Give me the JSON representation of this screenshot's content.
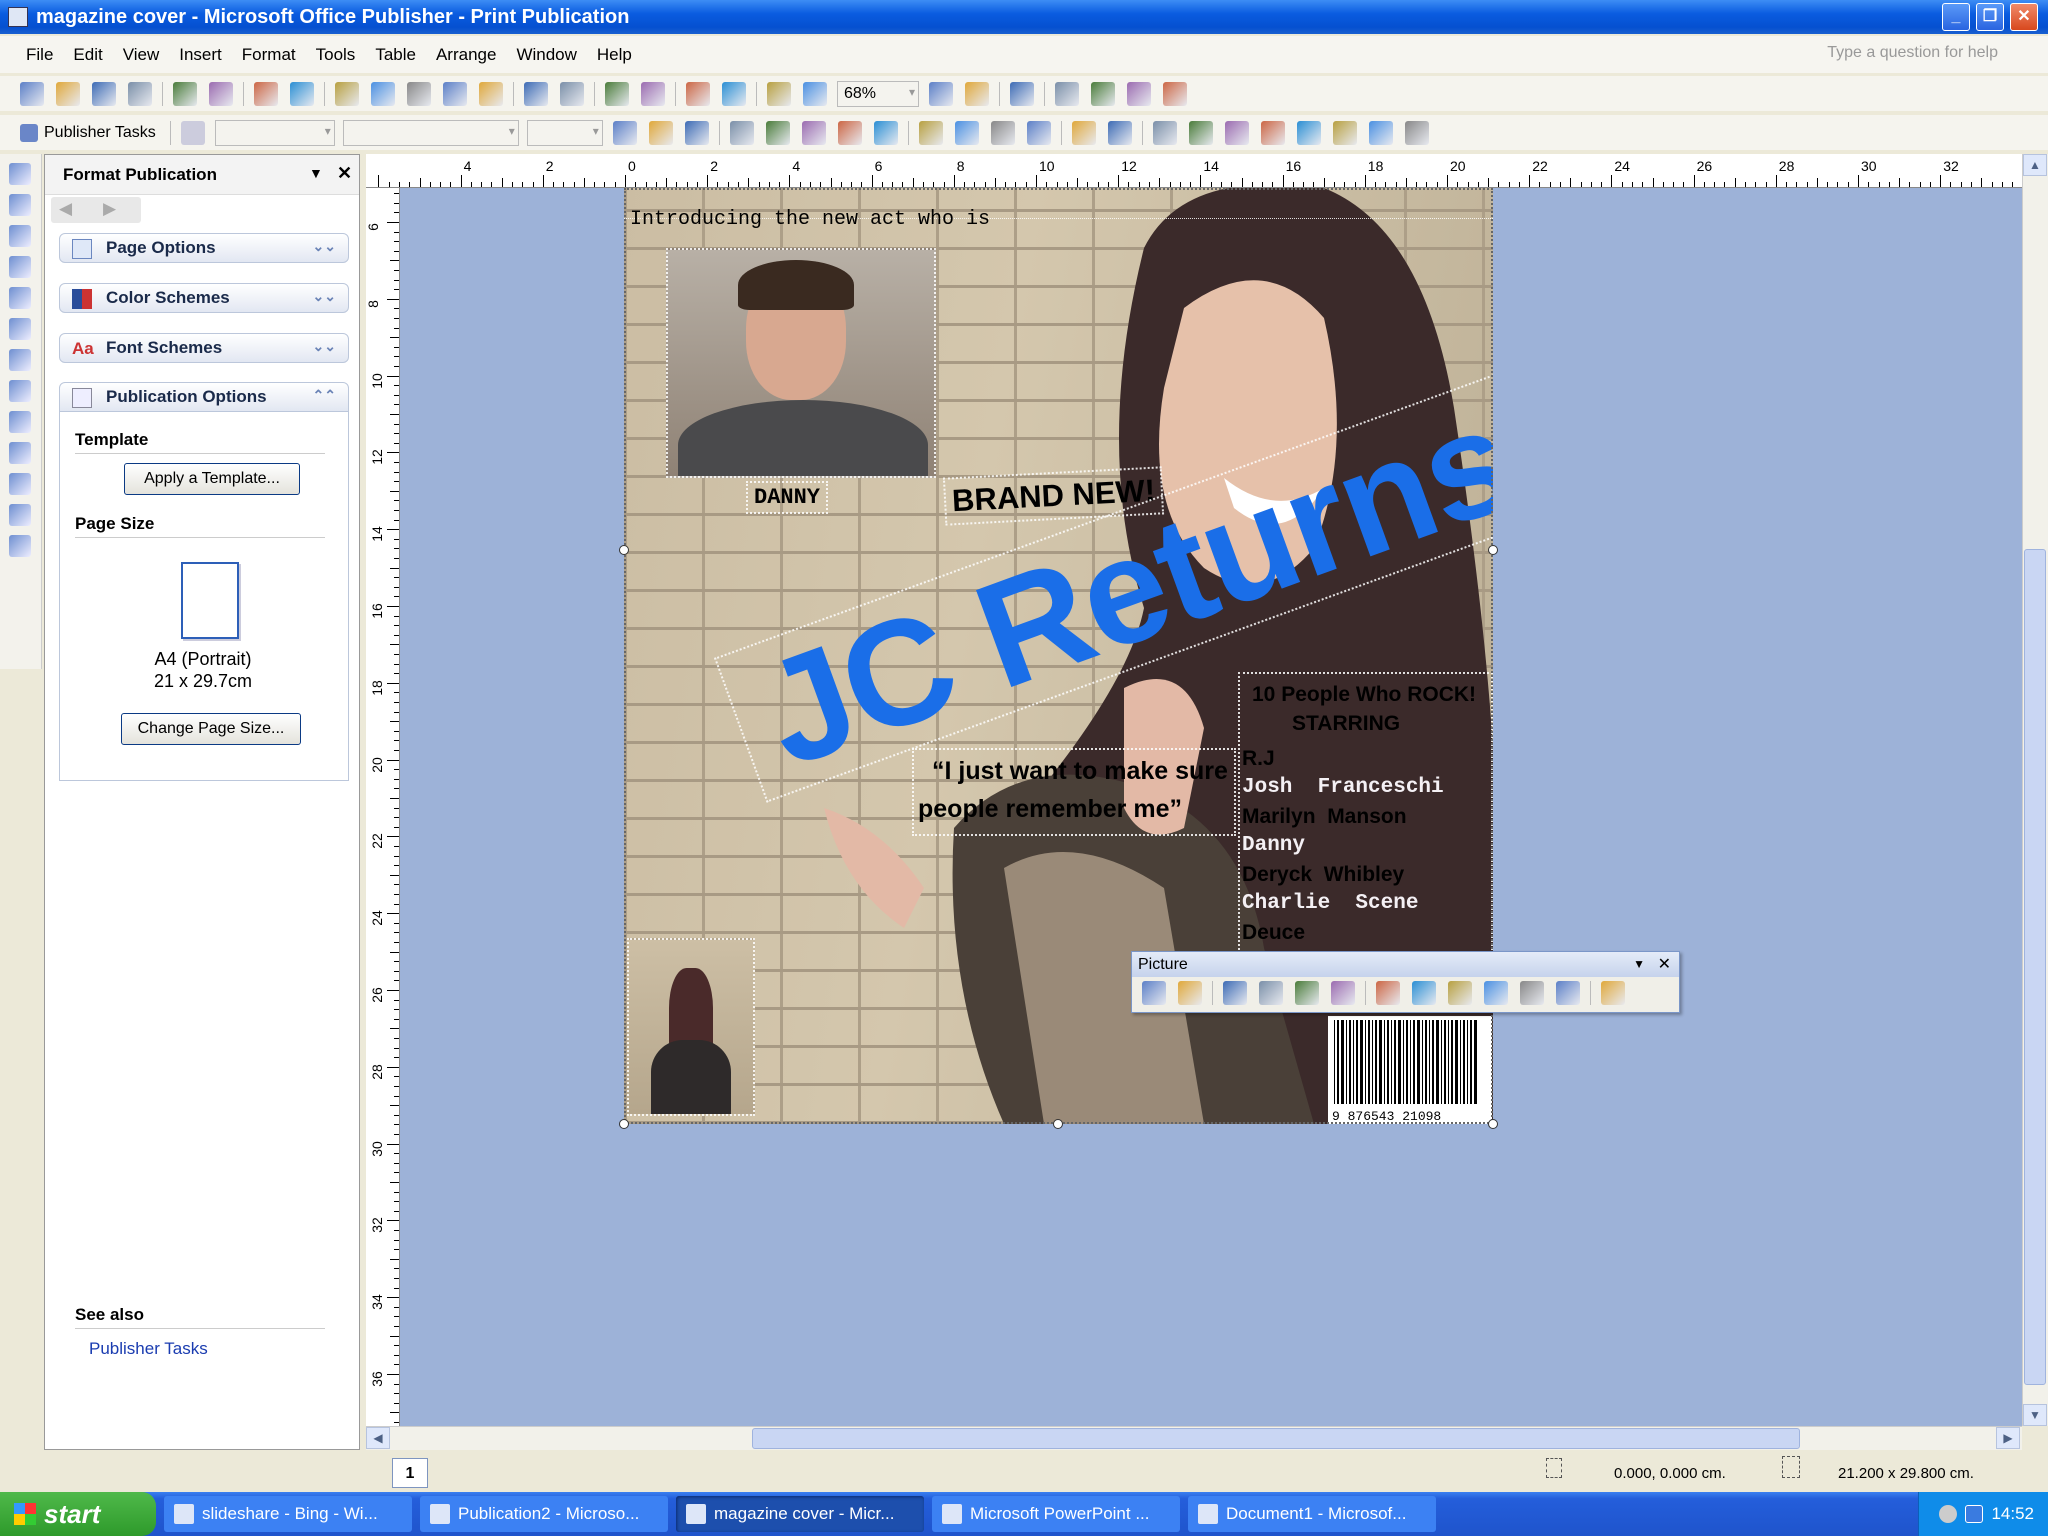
{
  "window": {
    "title": "magazine cover - Microsoft Office Publisher - Print Publication"
  },
  "menu": [
    "File",
    "Edit",
    "View",
    "Insert",
    "Format",
    "Tools",
    "Table",
    "Arrange",
    "Window",
    "Help"
  ],
  "help_placeholder": "Type a question for help",
  "toolbar_standard": {
    "icons": [
      "new-icon",
      "open-icon",
      "save-icon",
      "permission-icon",
      "|",
      "print-icon",
      "print-preview-icon",
      "|",
      "spelling-icon",
      "research-icon",
      "|",
      "cut-icon",
      "copy-icon",
      "paste-icon",
      "format-painter-icon",
      "brush-icon",
      "|",
      "undo-icon",
      "redo-icon",
      "|",
      "bring-to-front-icon",
      "rotate-icon",
      "|",
      "hyperlink-icon",
      "web-preview-icon",
      "|",
      "columns-icon",
      "pilcrow-icon"
    ],
    "zoom": "68%",
    "icons_after": [
      "zoom-out-icon",
      "zoom-in-icon",
      "|",
      "help-icon",
      "|",
      "link-textbox-icon",
      "unlink-textbox-icon",
      "previous-textbox-icon",
      "next-textbox-icon"
    ]
  },
  "toolbar_format": {
    "publisher_tasks": "Publisher Tasks",
    "icons": [
      "bold-icon",
      "italic-icon",
      "underline-icon",
      "|",
      "align-left-icon",
      "center-icon",
      "align-right-icon",
      "justify-icon",
      "line-spacing-icon",
      "|",
      "numbering-icon",
      "bullets-icon",
      "decrease-indent-icon",
      "increase-indent-icon",
      "|",
      "decrease-font-icon",
      "increase-font-icon",
      "|",
      "fill-color-icon",
      "line-color-icon",
      "font-color-icon",
      "line-style-icon",
      "dash-style-icon",
      "arrow-style-icon",
      "shadow-icon",
      "3d-icon"
    ]
  },
  "tools": [
    "select-icon",
    "text-box-icon",
    "table-icon",
    "wordart-icon",
    "picture-icon",
    "line-icon",
    "arrow-icon",
    "oval-icon",
    "rectangle-icon",
    "autoshapes-icon",
    "hot-spot-icon",
    "form-control-icon",
    "design-gallery-icon"
  ],
  "taskpane": {
    "title": "Format Publication",
    "sections": [
      "Page Options",
      "Color Schemes",
      "Font Schemes",
      "Publication Options"
    ],
    "template_label": "Template",
    "apply_template": "Apply a Template...",
    "page_size_label": "Page Size",
    "page_size_name": "A4 (Portrait)",
    "page_size_dims": "21 x 29.7cm",
    "change_page_size": "Change Page Size...",
    "see_also": "See also",
    "publisher_tasks_link": "Publisher Tasks"
  },
  "ruler": {
    "top": [
      "4",
      "2",
      "0",
      "2",
      "4",
      "6",
      "8",
      "10",
      "12",
      "14",
      "16",
      "18",
      "20",
      "22",
      "24",
      "26",
      "28",
      "30",
      "32"
    ],
    "left": [
      "6",
      "8",
      "10",
      "12",
      "14",
      "16",
      "18",
      "20",
      "22",
      "24",
      "26",
      "28",
      "30",
      "32",
      "34",
      "36"
    ]
  },
  "cover": {
    "intro": "Introducing the new act who is",
    "danny_caption": "DANNY",
    "brand_new": "BRAND NEW!",
    "headline": "JC Returns",
    "headline_color": "#1a6ee8",
    "quote_line1": "“I just want to make sure",
    "quote_line2": "people remember me”",
    "list_title": "10 People Who ROCK!",
    "list_sub": "STARRING",
    "list": [
      {
        "name": "R.J",
        "white": false
      },
      {
        "name": "Josh  Franceschi",
        "white": true
      },
      {
        "name": "Marilyn  Manson",
        "white": false
      },
      {
        "name": "Danny",
        "white": true
      },
      {
        "name": "Deryck  Whibley",
        "white": false
      },
      {
        "name": "Charlie  Scene",
        "white": true
      },
      {
        "name": "Deuce",
        "white": false
      }
    ],
    "barcode_number": "9 876543 21098"
  },
  "picture_toolbar": {
    "title": "Picture",
    "icons": [
      "insert-picture-icon",
      "color-icon",
      "|",
      "more-contrast-icon",
      "less-contrast-icon",
      "more-brightness-icon",
      "less-brightness-icon",
      "|",
      "crop-icon",
      "line-style-icon",
      "compress-icon",
      "text-wrapping-icon",
      "format-picture-icon",
      "set-transparent-icon",
      "|",
      "reset-picture-icon"
    ]
  },
  "status": {
    "page": "1",
    "position": "0.000, 0.000 cm.",
    "size": "21.200 x 29.800 cm."
  },
  "taskbar": {
    "start": "start",
    "items": [
      {
        "label": "slideshare - Bing - Wi...",
        "active": false
      },
      {
        "label": "Publication2 - Microso...",
        "active": false
      },
      {
        "label": "magazine cover - Micr...",
        "active": true
      },
      {
        "label": "Microsoft PowerPoint ...",
        "active": false
      },
      {
        "label": "Document1 - Microsof...",
        "active": false
      }
    ],
    "clock": "14:52"
  }
}
